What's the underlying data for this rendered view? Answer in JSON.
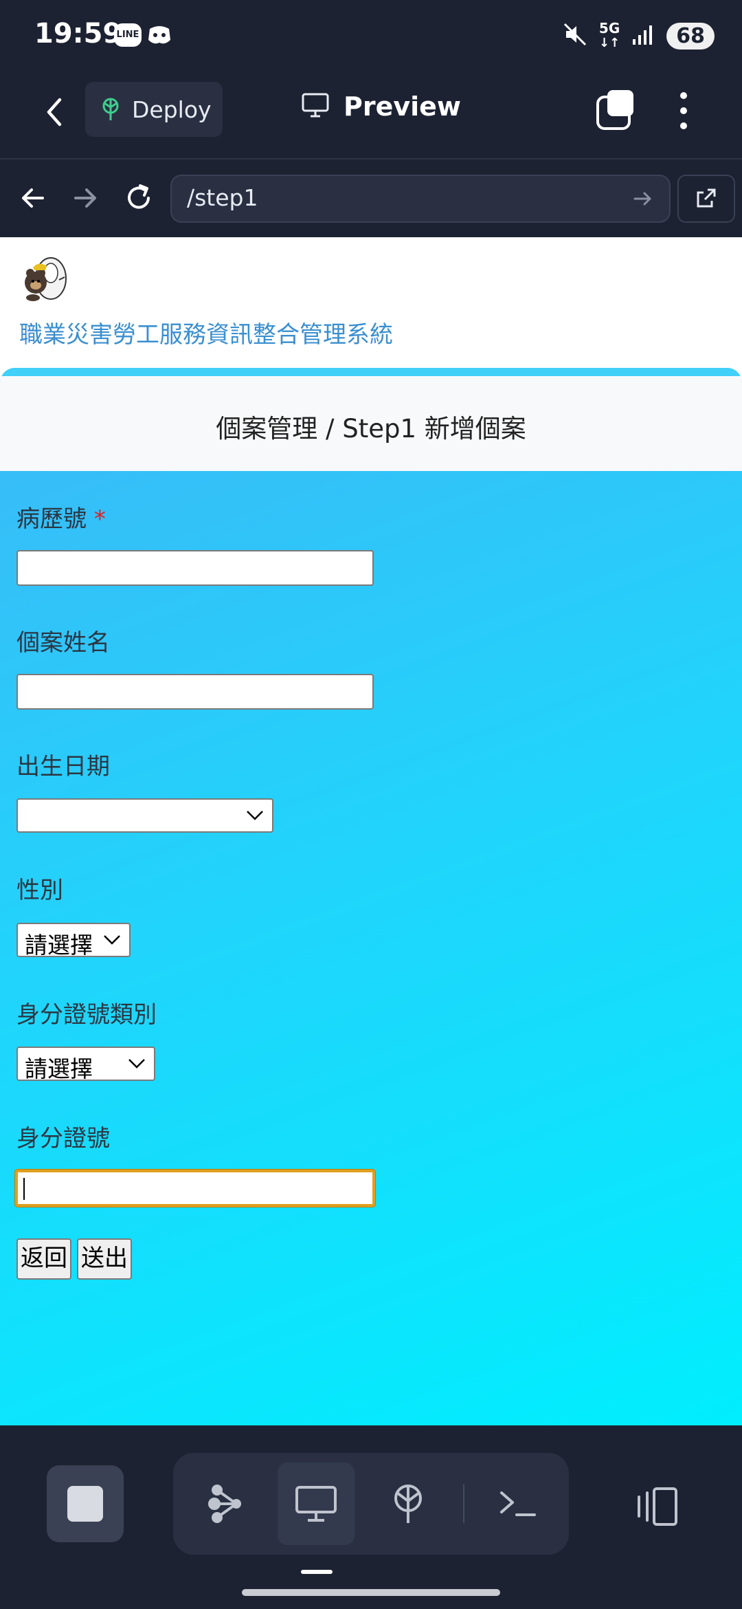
{
  "status_bar": {
    "time": "19:59",
    "app_icon_1": "LINE",
    "network": "5G",
    "battery": "68",
    "icons": [
      "line-icon",
      "discord-icon",
      "mute-icon",
      "5g-icon",
      "signal-icon",
      "battery-icon"
    ]
  },
  "app_bar": {
    "deploy_label": "Deploy",
    "preview_label": "Preview"
  },
  "browser": {
    "url": "/step1"
  },
  "site": {
    "title": "職業災害勞工服務資訊整合管理系統"
  },
  "page": {
    "heading": "個案管理 / Step1 新增個案",
    "fields": {
      "record_no_label": "病歷號",
      "required_mark": "*",
      "name_label": "個案姓名",
      "birth_label": "出生日期",
      "gender_label": "性別",
      "gender_selected": "請選擇",
      "id_type_label": "身分證號類別",
      "id_type_selected": "請選擇",
      "id_label": "身分證號"
    },
    "buttons": {
      "back": "返回",
      "submit": "送出"
    }
  },
  "colors": {
    "chrome_bg": "#1d2232",
    "site_title": "#3a8fd0",
    "gradient_start": "#3cb8f7",
    "gradient_end": "#00eefe",
    "focus_border": "#e0a020"
  }
}
